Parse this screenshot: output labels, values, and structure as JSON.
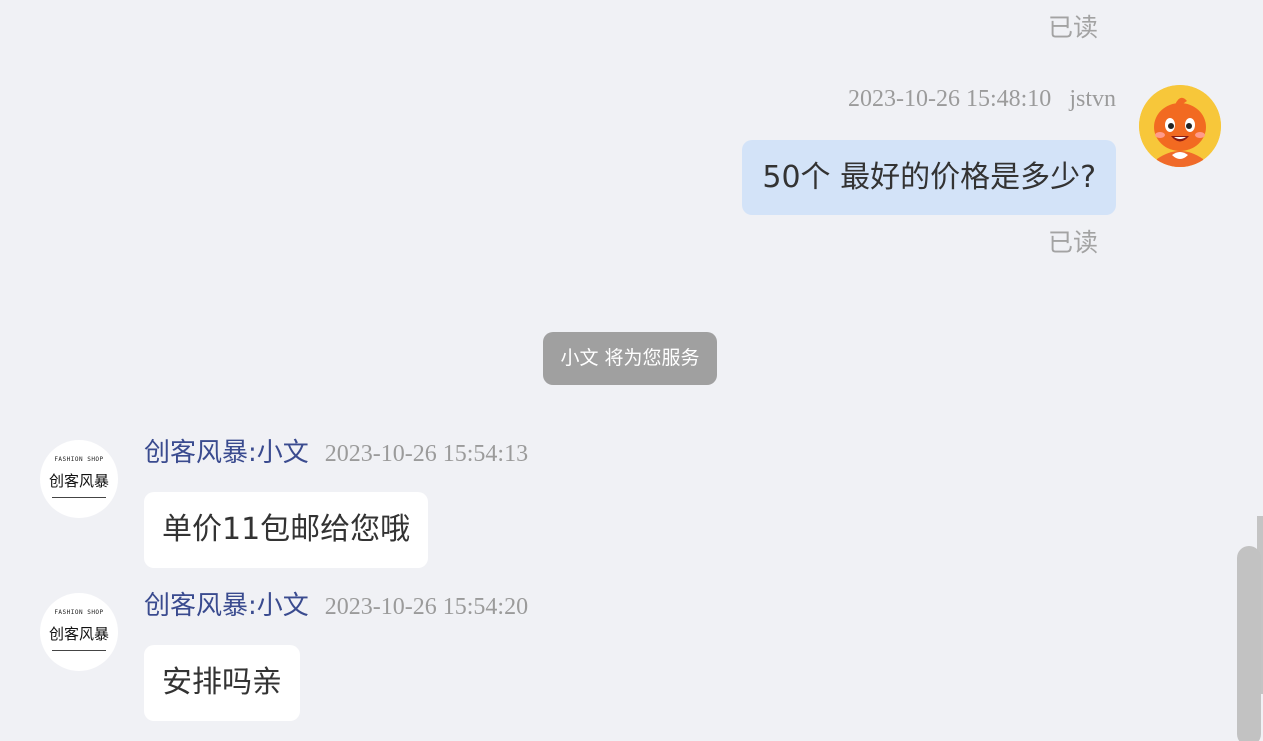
{
  "conversation": {
    "messages": [
      {
        "direction": "outgoing",
        "read_status_top": "已读"
      },
      {
        "direction": "outgoing",
        "timestamp": "2023-10-26 15:48:10",
        "sender": "jstvn",
        "text": "50个 最好的价格是多少?",
        "read_status": "已读",
        "avatar": "orange-cartoon-character-avatar"
      },
      {
        "direction": "system",
        "text": "小文 将为您服务"
      },
      {
        "direction": "incoming",
        "sender": "创客风暴:小文",
        "timestamp": "2023-10-26 15:54:13",
        "text": "单价11包邮给您哦"
      },
      {
        "direction": "incoming",
        "sender": "创客风暴:小文",
        "timestamp": "2023-10-26 15:54:20",
        "text": "安排吗亲"
      }
    ]
  },
  "shop_avatar": {
    "top_text": "FASHION SHOP",
    "brand_text": "创客风暴"
  },
  "colors": {
    "background": "#f0f1f5",
    "outgoing_bubble": "#d3e3f8",
    "incoming_bubble": "#ffffff",
    "sender_name": "#3a4b8f",
    "system_notice": "#a0a0a0"
  }
}
